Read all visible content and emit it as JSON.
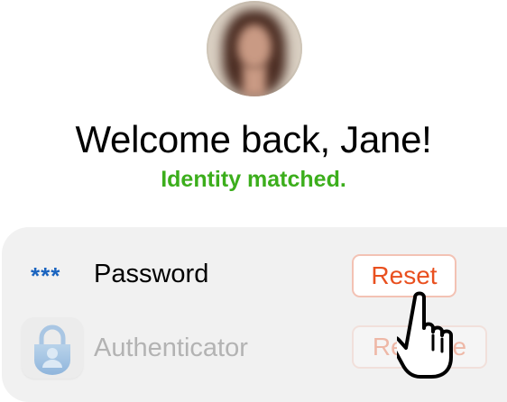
{
  "header": {
    "avatar_icon": "user-photo-blurred",
    "title": "Welcome back, Jane!",
    "subtitle": "Identity matched.",
    "subtitle_color": "#3cae1c"
  },
  "methods": [
    {
      "icon": "password-dots-icon",
      "icon_text": "***",
      "label": "Password",
      "action_label": "Reset",
      "enabled": true
    },
    {
      "icon": "authenticator-app-icon",
      "label": "Authenticator",
      "action_label": "Remove",
      "enabled": false
    }
  ],
  "colors": {
    "accent": "#e9501f",
    "dots": "#1b64bf",
    "panel": "#f1f1f1"
  },
  "cursor_icon": "hand-pointer-icon"
}
